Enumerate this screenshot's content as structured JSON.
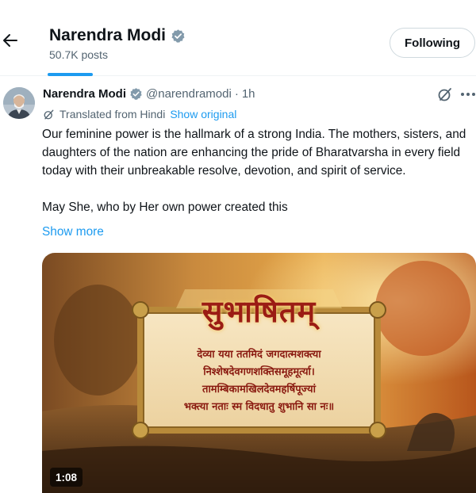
{
  "header": {
    "name": "Narendra Modi",
    "posts_count": "50.7K posts",
    "follow_label": "Following"
  },
  "post": {
    "author_name": "Narendra Modi",
    "handle": "@narendramodi",
    "separator": "·",
    "time": "1h",
    "translated_label": "Translated from Hindi",
    "show_original_label": "Show original",
    "text_paragraph_1": "Our feminine power is the hallmark of a strong India. The mothers, sisters, and daughters of the nation are enhancing the pride of Bharatvarsha in every field today with their unbreakable resolve, devotion, and spirit of service.",
    "text_paragraph_2": "May She, who by Her own power created this",
    "show_more_label": "Show more"
  },
  "media": {
    "title": "सुभाषितम्",
    "verse_lines": [
      "देव्या यया ततमिदं जगदात्मशक्त्या",
      "निश्शेषदेवगणशक्तिसमूहमूर्त्या।",
      "तामम्बिकामखिलदेवमहर्षिपूज्यां",
      "भक्त्या नताः स्म विदधातु शुभानि सा नः॥"
    ],
    "duration": "1:08"
  },
  "icons": {
    "back": "arrow-left-icon",
    "verified": "verified-badge-icon",
    "grok": "grok-icon",
    "more": "more-dots-icon",
    "translate": "translate-icon"
  },
  "colors": {
    "accent": "#1d9bf0",
    "verified_badge": "#829aab",
    "text_primary": "#0f1419",
    "text_secondary": "#536471"
  }
}
